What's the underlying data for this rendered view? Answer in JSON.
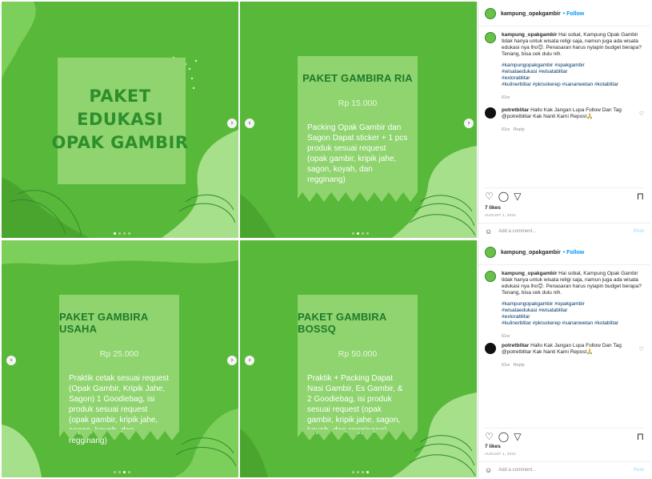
{
  "slides": {
    "edukasi": {
      "title_lines": [
        "PAKET",
        "EDUKASI",
        "OPAK GAMBIR"
      ]
    },
    "ria": {
      "title": "PAKET GAMBIRA RIA",
      "price": "Rp 15.000",
      "desc": "Packing Opak Gambir dan Sagon Dapat sticker + 1 pcs produk sesuai request (opak gambir, kripik jahe, sagon, koyah, dan regginang)"
    },
    "usaha": {
      "title": "PAKET GAMBIRA USAHA",
      "price": "Rp 25.000",
      "desc": "Praktik cetak sesuai request (Opak Gambir, Kripik Jahe, Sagon) 1 Goodiebag, isi produk sesuai request (opak gambir, kripik jahe, sagon, koyah, dan regginang)"
    },
    "bossq": {
      "title": "PAKET GAMBIRA BOSSQ",
      "price": "Rp 50.000",
      "desc": "Praktik + Packing Dapat Nasi Gambir, Es Gambir, & 2 Goodiebag, isi produk sesuai request (opak gambir, kripik jahe, sagon, koyah, dan regginang)"
    }
  },
  "nav": {
    "next": "›",
    "prev": "‹"
  },
  "post": {
    "username": "kampung_opakgambir",
    "follow": "• Follow",
    "more": "···",
    "caption": "Hai sobat, Kampung Opak Gambir tidak hanya untuk wisata religi saja, namun juga ada wisata edukasi nya lho😊. Penasaran harus nyiapin budget berapa? Tenang, bisa cek dulu nih.",
    "hashtags": [
      "#kampungopakgambir #opakgambir",
      "#wisataedukasi #wisatablitar",
      "#exlorablitar",
      "#kulinerblitar #pkisokerep #sananwetan #kotablitar"
    ],
    "caption_age": "61w",
    "comment": {
      "user": "potretblitar",
      "text": "Hallo Kak Jangan Lupa Follow Dan Tag @potretblitar Kak Nanti Kami Repost🙏",
      "age": "61w",
      "reply": "Reply"
    },
    "likes": "7 likes",
    "date": "AUGUST 1, 2021",
    "add_comment_placeholder": "Add a comment...",
    "post_label": "Post",
    "icons": {
      "like": "♡",
      "comment": "◯",
      "share": "▽",
      "save": "⊓",
      "emoji": "☺",
      "small_heart": "♡"
    }
  }
}
